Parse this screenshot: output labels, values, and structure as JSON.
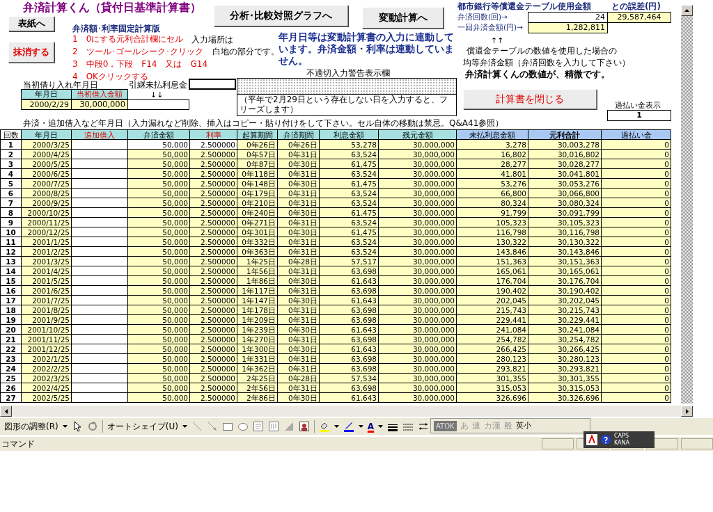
{
  "title": "弁済計算くん（貸付日基準計算書）",
  "cover_button": {
    "label": "表紙へ",
    "kind": "plain"
  },
  "delete_button": {
    "label": "抹消する",
    "kind": "alert"
  },
  "graph_button": {
    "label": "分析･比較対照グラフへ",
    "kind": "plain"
  },
  "variable_button": {
    "label": "変動計算へ",
    "kind": "plain"
  },
  "close_button": {
    "label": "計算書を閉じる",
    "kind": "alert"
  },
  "instructions": {
    "heading": "弁済額･利率固定計算版",
    "steps": [
      "1　0にする元利合計欄にセル",
      "2　ツール･ゴールシーク･クリック",
      "3　中段0，下段　F14　又は　G14",
      "4　OKクリックする"
    ]
  },
  "input_note": [
    "入力場所は",
    "白地の部分です。"
  ],
  "link_note": "年月日等は変動計算書の入力に連動しています。弁済金額・利率は連動していません。",
  "initial_loan": {
    "label": "当初借り入れ年月日",
    "columns": [
      {
        "label": "年月日",
        "kind": "plain"
      },
      {
        "label": "当初借入金額",
        "kind": "required"
      }
    ],
    "date": "2000/2/29",
    "amount": "30,000,000"
  },
  "carried_interest": {
    "label": "引継未払利息金",
    "arrows": "↓↓"
  },
  "warning": {
    "label": "不適切入力警告表示欄",
    "note": "（平年で2月29日という存在しない日を入力すると、フリーズします）"
  },
  "bank_table": {
    "heading": "都市銀行等償還金テーブル使用金額",
    "diff_heading": "との誤差(円)",
    "rows": [
      {
        "label": "弁済回数(回)→",
        "value": "24",
        "shaded": false,
        "diff": "29,587,464"
      },
      {
        "label": "一回弁済金額(円)→",
        "value": "1,282,811",
        "shaded": true
      }
    ],
    "arrows": "↑↑",
    "notes": [
      "償還金テーブルの数値を使用した場合の",
      "均等弁済金額（弁済回数を入力して下さい）"
    ],
    "conclusion": "弁済計算くんの数値が、精微です。"
  },
  "overpay_display": {
    "label": "過払い金表示",
    "value": "1"
  },
  "table": {
    "caption": "弁済・追加借入など年月日（入力漏れなど削除、挿入はコピー・貼り付けをして下さい。セル自体の移動は禁忌。Q&A41参照）",
    "columns": [
      {
        "label": "回数",
        "color": "#ffffff",
        "kind": "plain"
      },
      {
        "label": "年月日",
        "color": "#a6e0e0",
        "kind": "plain"
      },
      {
        "label": "追加借入",
        "color": "#a6e0e0",
        "kind": "required"
      },
      {
        "label": "弁済金額",
        "color": "#a6e0e0",
        "kind": "plain"
      },
      {
        "label": "利率",
        "color": "#a6e0e0",
        "kind": "required"
      },
      {
        "label": "起算期間",
        "color": "#a6e0e0",
        "kind": "plain"
      },
      {
        "label": "弁済期間",
        "color": "#a6e0e0",
        "kind": "plain"
      },
      {
        "label": "利息金額",
        "color": "#a6e0e0",
        "kind": "plain"
      },
      {
        "label": "残元金額",
        "color": "#a6e0e0",
        "kind": "plain"
      },
      {
        "label": "未払利息金額",
        "color": "#a9c9f2",
        "kind": "plain"
      },
      {
        "label": "元利合計",
        "color": "#a9c9f2",
        "kind": "total"
      },
      {
        "label": "過払い金",
        "color": "#a9c9f2",
        "kind": "plain"
      }
    ],
    "rows": [
      {
        "no": "1",
        "date": "2000/3/25",
        "payment": "50,000",
        "rate": "2.500000",
        "elapsed": "0年26日",
        "period": "0年26日",
        "interest": "53,278",
        "principal": "30,000,000",
        "unpaid": "3,278",
        "total": "30,003,278",
        "overpaid": "0",
        "payment_shaded": false
      },
      {
        "no": "2",
        "date": "2000/4/25",
        "payment": "50,000",
        "rate": "2.500000",
        "elapsed": "0年57日",
        "period": "0年31日",
        "interest": "63,524",
        "principal": "30,000,000",
        "unpaid": "16,802",
        "total": "30,016,802",
        "overpaid": "0",
        "payment_shaded": true
      },
      {
        "no": "3",
        "date": "2000/5/25",
        "payment": "50,000",
        "rate": "2.500000",
        "elapsed": "0年87日",
        "period": "0年30日",
        "interest": "61,475",
        "principal": "30,000,000",
        "unpaid": "28,277",
        "total": "30,028,277",
        "overpaid": "0",
        "payment_shaded": true
      },
      {
        "no": "4",
        "date": "2000/6/25",
        "payment": "50,000",
        "rate": "2.500000",
        "elapsed": "0年118日",
        "period": "0年31日",
        "interest": "63,524",
        "principal": "30,000,000",
        "unpaid": "41,801",
        "total": "30,041,801",
        "overpaid": "0",
        "payment_shaded": true
      },
      {
        "no": "5",
        "date": "2000/7/25",
        "payment": "50,000",
        "rate": "2.500000",
        "elapsed": "0年148日",
        "period": "0年30日",
        "interest": "61,475",
        "principal": "30,000,000",
        "unpaid": "53,276",
        "total": "30,053,276",
        "overpaid": "0",
        "payment_shaded": true
      },
      {
        "no": "6",
        "date": "2000/8/25",
        "payment": "50,000",
        "rate": "2.500000",
        "elapsed": "0年179日",
        "period": "0年31日",
        "interest": "63,524",
        "principal": "30,000,000",
        "unpaid": "66,800",
        "total": "30,066,800",
        "overpaid": "0",
        "payment_shaded": true
      },
      {
        "no": "7",
        "date": "2000/9/25",
        "payment": "50,000",
        "rate": "2.500000",
        "elapsed": "0年210日",
        "period": "0年31日",
        "interest": "63,524",
        "principal": "30,000,000",
        "unpaid": "80,324",
        "total": "30,080,324",
        "overpaid": "0",
        "payment_shaded": true
      },
      {
        "no": "8",
        "date": "2000/10/25",
        "payment": "50,000",
        "rate": "2.500000",
        "elapsed": "0年240日",
        "period": "0年30日",
        "interest": "61,475",
        "principal": "30,000,000",
        "unpaid": "91,799",
        "total": "30,091,799",
        "overpaid": "0",
        "payment_shaded": true
      },
      {
        "no": "9",
        "date": "2000/11/25",
        "payment": "50,000",
        "rate": "2.500000",
        "elapsed": "0年271日",
        "period": "0年31日",
        "interest": "63,524",
        "principal": "30,000,000",
        "unpaid": "105,323",
        "total": "30,105,323",
        "overpaid": "0",
        "payment_shaded": true
      },
      {
        "no": "10",
        "date": "2000/12/25",
        "payment": "50,000",
        "rate": "2.500000",
        "elapsed": "0年301日",
        "period": "0年30日",
        "interest": "61,475",
        "principal": "30,000,000",
        "unpaid": "116,798",
        "total": "30,116,798",
        "overpaid": "0",
        "payment_shaded": true
      },
      {
        "no": "11",
        "date": "2001/1/25",
        "payment": "50,000",
        "rate": "2.500000",
        "elapsed": "0年332日",
        "period": "0年31日",
        "interest": "63,524",
        "principal": "30,000,000",
        "unpaid": "130,322",
        "total": "30,130,322",
        "overpaid": "0",
        "payment_shaded": true
      },
      {
        "no": "12",
        "date": "2001/2/25",
        "payment": "50,000",
        "rate": "2.500000",
        "elapsed": "0年363日",
        "period": "0年31日",
        "interest": "63,524",
        "principal": "30,000,000",
        "unpaid": "143,846",
        "total": "30,143,846",
        "overpaid": "0",
        "payment_shaded": true
      },
      {
        "no": "13",
        "date": "2001/3/25",
        "payment": "50,000",
        "rate": "2.500000",
        "elapsed": "1年25日",
        "period": "0年28日",
        "interest": "57,517",
        "principal": "30,000,000",
        "unpaid": "151,363",
        "total": "30,151,363",
        "overpaid": "0",
        "payment_shaded": true
      },
      {
        "no": "14",
        "date": "2001/4/25",
        "payment": "50,000",
        "rate": "2.500000",
        "elapsed": "1年56日",
        "period": "0年31日",
        "interest": "63,698",
        "principal": "30,000,000",
        "unpaid": "165,061",
        "total": "30,165,061",
        "overpaid": "0",
        "payment_shaded": true
      },
      {
        "no": "15",
        "date": "2001/5/25",
        "payment": "50,000",
        "rate": "2.500000",
        "elapsed": "1年86日",
        "period": "0年30日",
        "interest": "61,643",
        "principal": "30,000,000",
        "unpaid": "176,704",
        "total": "30,176,704",
        "overpaid": "0",
        "payment_shaded": true
      },
      {
        "no": "16",
        "date": "2001/6/25",
        "payment": "50,000",
        "rate": "2.500000",
        "elapsed": "1年117日",
        "period": "0年31日",
        "interest": "63,698",
        "principal": "30,000,000",
        "unpaid": "190,402",
        "total": "30,190,402",
        "overpaid": "0",
        "payment_shaded": true
      },
      {
        "no": "17",
        "date": "2001/7/25",
        "payment": "50,000",
        "rate": "2.500000",
        "elapsed": "1年147日",
        "period": "0年30日",
        "interest": "61,643",
        "principal": "30,000,000",
        "unpaid": "202,045",
        "total": "30,202,045",
        "overpaid": "0",
        "payment_shaded": true
      },
      {
        "no": "18",
        "date": "2001/8/25",
        "payment": "50,000",
        "rate": "2.500000",
        "elapsed": "1年178日",
        "period": "0年31日",
        "interest": "63,698",
        "principal": "30,000,000",
        "unpaid": "215,743",
        "total": "30,215,743",
        "overpaid": "0",
        "payment_shaded": true
      },
      {
        "no": "19",
        "date": "2001/9/25",
        "payment": "50,000",
        "rate": "2.500000",
        "elapsed": "1年209日",
        "period": "0年31日",
        "interest": "63,698",
        "principal": "30,000,000",
        "unpaid": "229,441",
        "total": "30,229,441",
        "overpaid": "0",
        "payment_shaded": true
      },
      {
        "no": "20",
        "date": "2001/10/25",
        "payment": "50,000",
        "rate": "2.500000",
        "elapsed": "1年239日",
        "period": "0年30日",
        "interest": "61,643",
        "principal": "30,000,000",
        "unpaid": "241,084",
        "total": "30,241,084",
        "overpaid": "0",
        "payment_shaded": true
      },
      {
        "no": "21",
        "date": "2001/11/25",
        "payment": "50,000",
        "rate": "2.500000",
        "elapsed": "1年270日",
        "period": "0年31日",
        "interest": "63,698",
        "principal": "30,000,000",
        "unpaid": "254,782",
        "total": "30,254,782",
        "overpaid": "0",
        "payment_shaded": true
      },
      {
        "no": "22",
        "date": "2001/12/25",
        "payment": "50,000",
        "rate": "2.500000",
        "elapsed": "1年300日",
        "period": "0年30日",
        "interest": "61,643",
        "principal": "30,000,000",
        "unpaid": "266,425",
        "total": "30,266,425",
        "overpaid": "0",
        "payment_shaded": true
      },
      {
        "no": "23",
        "date": "2002/1/25",
        "payment": "50,000",
        "rate": "2.500000",
        "elapsed": "1年331日",
        "period": "0年31日",
        "interest": "63,698",
        "principal": "30,000,000",
        "unpaid": "280,123",
        "total": "30,280,123",
        "overpaid": "0",
        "payment_shaded": true
      },
      {
        "no": "24",
        "date": "2002/2/25",
        "payment": "50,000",
        "rate": "2.500000",
        "elapsed": "1年362日",
        "period": "0年31日",
        "interest": "63,698",
        "principal": "30,000,000",
        "unpaid": "293,821",
        "total": "30,293,821",
        "overpaid": "0",
        "payment_shaded": true
      },
      {
        "no": "25",
        "date": "2002/3/25",
        "payment": "50,000",
        "rate": "2.500000",
        "elapsed": "2年25日",
        "period": "0年28日",
        "interest": "57,534",
        "principal": "30,000,000",
        "unpaid": "301,355",
        "total": "30,301,355",
        "overpaid": "0",
        "payment_shaded": true
      },
      {
        "no": "26",
        "date": "2002/4/25",
        "payment": "50,000",
        "rate": "2.500000",
        "elapsed": "2年56日",
        "period": "0年31日",
        "interest": "63,698",
        "principal": "30,000,000",
        "unpaid": "315,053",
        "total": "30,315,053",
        "overpaid": "0",
        "payment_shaded": true
      },
      {
        "no": "27",
        "date": "2002/5/25",
        "payment": "50,000",
        "rate": "2.500000",
        "elapsed": "2年86日",
        "period": "0年30日",
        "interest": "61,643",
        "principal": "30,000,000",
        "unpaid": "326,696",
        "total": "30,326,696",
        "overpaid": "0",
        "payment_shaded": true
      }
    ]
  },
  "drawing_toolbar": {
    "adjust_menu": "図形の調整(R)",
    "autoshape_menu": "オートシェイプ(U)",
    "font_color_glyph": "A"
  },
  "ime_bar": {
    "items": [
      {
        "label": "ATOK",
        "kind": "brand"
      },
      {
        "label": "あ",
        "kind": "mode"
      },
      {
        "label": "連",
        "kind": "mode"
      },
      {
        "label": "カ漢",
        "kind": "mode"
      },
      {
        "label": "般",
        "kind": "mode"
      },
      {
        "label": "英小",
        "kind": "small"
      }
    ]
  },
  "ime_status": {
    "caps": "CAPS",
    "kana": "KANA"
  },
  "status_bar": {
    "mode": "コマンド"
  }
}
